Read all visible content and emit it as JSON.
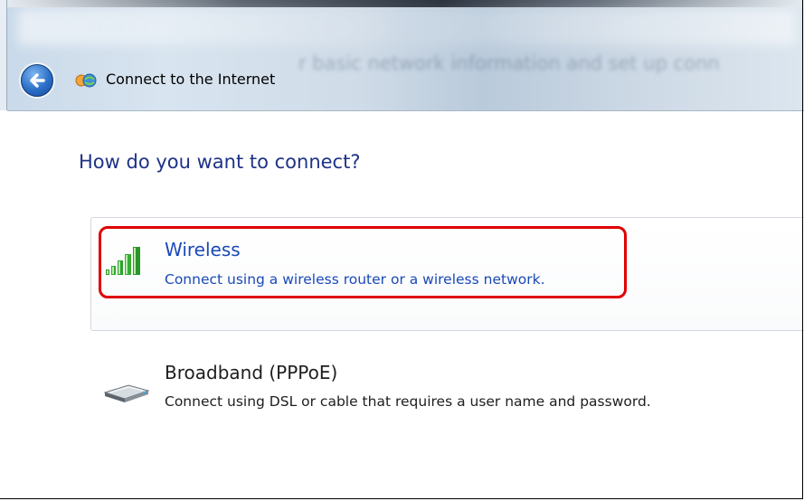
{
  "window": {
    "title": "Connect to the Internet",
    "background_text": "r basic network information and set up conn"
  },
  "content": {
    "heading": "How do you want to connect?",
    "options": [
      {
        "title": "Wireless",
        "description": "Connect using a wireless router or a wireless network.",
        "icon": "wireless-signal-icon",
        "highlighted": true
      },
      {
        "title": "Broadband (PPPoE)",
        "description": "Connect using DSL or cable that requires a user name and password.",
        "icon": "broadband-modem-icon",
        "highlighted": false
      }
    ]
  },
  "colors": {
    "link_blue": "#1a49b7",
    "heading_blue": "#1e3287",
    "highlight_red": "#e00000"
  }
}
